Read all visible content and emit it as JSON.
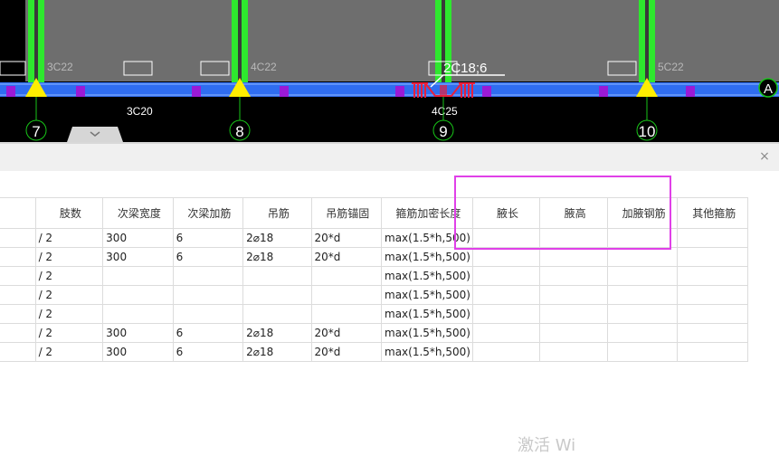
{
  "cad": {
    "colors": {
      "background": "#000000",
      "column": "#2ee82e",
      "beam": "#2f6df0",
      "upper_area": "#6e6e6e",
      "marker": "#ffee00",
      "stirrup": "#9b1ad6",
      "hanger": "#e8203c",
      "grid_bubble": "#18c418"
    },
    "column_labels": [
      "3C22",
      "4C22",
      "5C22"
    ],
    "beam_labels": [
      "3C20",
      "4C25"
    ],
    "annotation": "2C18;6",
    "axis_label": "A",
    "grid_labels": [
      "7",
      "8",
      "9",
      "10"
    ]
  },
  "panel": {
    "close_icon": "×"
  },
  "table": {
    "columns": [
      "肢数",
      "次梁宽度",
      "次梁加筋",
      "吊筋",
      "吊筋锚固",
      "箍筋加密长度",
      "腋长",
      "腋高",
      "加腋钢筋",
      "其他箍筋"
    ],
    "rows": [
      [
        "/ 2",
        "300",
        "6",
        "2⌀18",
        "20*d",
        "max(1.5*h,500)",
        "",
        "",
        "",
        ""
      ],
      [
        "/ 2",
        "300",
        "6",
        "2⌀18",
        "20*d",
        "max(1.5*h,500)",
        "",
        "",
        "",
        ""
      ],
      [
        "/ 2",
        "",
        "",
        "",
        "",
        "max(1.5*h,500)",
        "",
        "",
        "",
        ""
      ],
      [
        "/ 2",
        "",
        "",
        "",
        "",
        "max(1.5*h,500)",
        "",
        "",
        "",
        ""
      ],
      [
        "/ 2",
        "",
        "",
        "",
        "",
        "max(1.5*h,500)",
        "",
        "",
        "",
        ""
      ],
      [
        "/ 2",
        "300",
        "6",
        "2⌀18",
        "20*d",
        "max(1.5*h,500)",
        "",
        "",
        "",
        ""
      ],
      [
        "/ 2",
        "300",
        "6",
        "2⌀18",
        "20*d",
        "max(1.5*h,500)",
        "",
        "",
        "",
        ""
      ]
    ]
  },
  "watermark": "激活 Wi"
}
